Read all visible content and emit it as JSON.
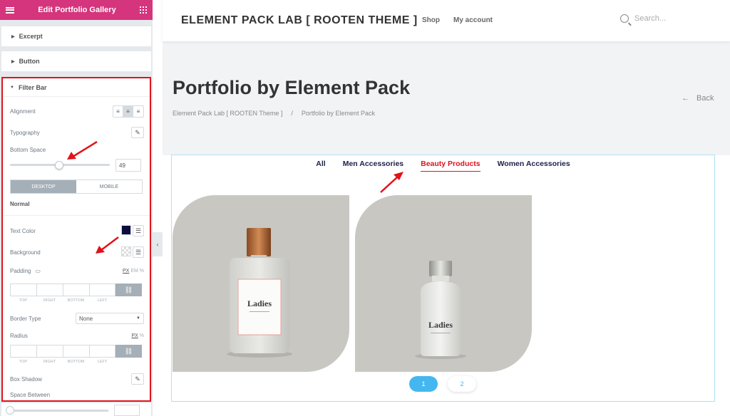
{
  "panel": {
    "title": "Edit Portfolio Gallery",
    "sections": [
      "Excerpt",
      "Button"
    ],
    "filter_bar": {
      "title": "Filter Bar",
      "alignment_label": "Alignment",
      "typography_label": "Typography",
      "bottom_space_label": "Bottom Space",
      "bottom_space_value": "49",
      "bottom_space_fraction": 0.49,
      "device_tabs": [
        "DESKTOP",
        "MOBILE"
      ],
      "state_label": "Normal",
      "text_color_label": "Text Color",
      "text_color": "#0b0d3f",
      "background_label": "Background",
      "padding_label": "Padding",
      "padding_units": [
        "PX",
        "EM",
        "%"
      ],
      "dimension_labels": [
        "TOP",
        "RIGHT",
        "BOTTOM",
        "LEFT"
      ],
      "border_type_label": "Border Type",
      "border_type_value": "None",
      "radius_label": "Radius",
      "radius_units": [
        "PX",
        "%"
      ],
      "box_shadow_label": "Box Shadow",
      "space_between_label": "Space Between"
    },
    "accent_color": "#d5357d"
  },
  "site": {
    "brand": "ELEMENT PACK LAB [ ROOTEN THEME ]",
    "nav": [
      "Shop",
      "My account"
    ],
    "search_placeholder": "Search...",
    "page_title": "Portfolio by Element Pack",
    "breadcrumb": [
      "Element Pack Lab [ ROOTEN Theme ]",
      "/",
      "Portfolio by Element Pack"
    ],
    "back_label": "Back",
    "filters": [
      {
        "label": "All",
        "active": false
      },
      {
        "label": "Men Accessories",
        "active": false
      },
      {
        "label": "Beauty Products",
        "active": true
      },
      {
        "label": "Women Accessories",
        "active": false
      }
    ],
    "products": [
      {
        "brand_text": "Ladies",
        "icon": "tall-bottle-icon"
      },
      {
        "brand_text": "Ladies",
        "icon": "short-bottle-icon"
      }
    ],
    "pagination": [
      "1",
      "2"
    ],
    "active_color": "#e0131b",
    "pager_color": "#45b7f0"
  }
}
